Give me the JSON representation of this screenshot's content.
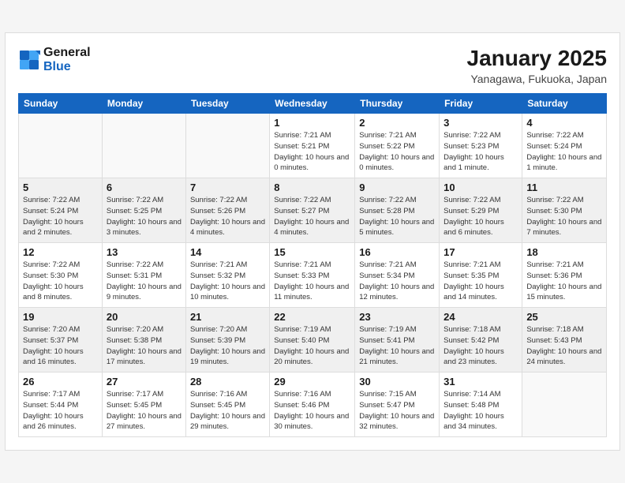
{
  "header": {
    "logo_general": "General",
    "logo_blue": "Blue",
    "month_title": "January 2025",
    "location": "Yanagawa, Fukuoka, Japan"
  },
  "weekdays": [
    "Sunday",
    "Monday",
    "Tuesday",
    "Wednesday",
    "Thursday",
    "Friday",
    "Saturday"
  ],
  "weeks": [
    {
      "shaded": false,
      "days": [
        {
          "day": "",
          "info": ""
        },
        {
          "day": "",
          "info": ""
        },
        {
          "day": "",
          "info": ""
        },
        {
          "day": "1",
          "info": "Sunrise: 7:21 AM\nSunset: 5:21 PM\nDaylight: 10 hours\nand 0 minutes."
        },
        {
          "day": "2",
          "info": "Sunrise: 7:21 AM\nSunset: 5:22 PM\nDaylight: 10 hours\nand 0 minutes."
        },
        {
          "day": "3",
          "info": "Sunrise: 7:22 AM\nSunset: 5:23 PM\nDaylight: 10 hours\nand 1 minute."
        },
        {
          "day": "4",
          "info": "Sunrise: 7:22 AM\nSunset: 5:24 PM\nDaylight: 10 hours\nand 1 minute."
        }
      ]
    },
    {
      "shaded": true,
      "days": [
        {
          "day": "5",
          "info": "Sunrise: 7:22 AM\nSunset: 5:24 PM\nDaylight: 10 hours\nand 2 minutes."
        },
        {
          "day": "6",
          "info": "Sunrise: 7:22 AM\nSunset: 5:25 PM\nDaylight: 10 hours\nand 3 minutes."
        },
        {
          "day": "7",
          "info": "Sunrise: 7:22 AM\nSunset: 5:26 PM\nDaylight: 10 hours\nand 4 minutes."
        },
        {
          "day": "8",
          "info": "Sunrise: 7:22 AM\nSunset: 5:27 PM\nDaylight: 10 hours\nand 4 minutes."
        },
        {
          "day": "9",
          "info": "Sunrise: 7:22 AM\nSunset: 5:28 PM\nDaylight: 10 hours\nand 5 minutes."
        },
        {
          "day": "10",
          "info": "Sunrise: 7:22 AM\nSunset: 5:29 PM\nDaylight: 10 hours\nand 6 minutes."
        },
        {
          "day": "11",
          "info": "Sunrise: 7:22 AM\nSunset: 5:30 PM\nDaylight: 10 hours\nand 7 minutes."
        }
      ]
    },
    {
      "shaded": false,
      "days": [
        {
          "day": "12",
          "info": "Sunrise: 7:22 AM\nSunset: 5:30 PM\nDaylight: 10 hours\nand 8 minutes."
        },
        {
          "day": "13",
          "info": "Sunrise: 7:22 AM\nSunset: 5:31 PM\nDaylight: 10 hours\nand 9 minutes."
        },
        {
          "day": "14",
          "info": "Sunrise: 7:21 AM\nSunset: 5:32 PM\nDaylight: 10 hours\nand 10 minutes."
        },
        {
          "day": "15",
          "info": "Sunrise: 7:21 AM\nSunset: 5:33 PM\nDaylight: 10 hours\nand 11 minutes."
        },
        {
          "day": "16",
          "info": "Sunrise: 7:21 AM\nSunset: 5:34 PM\nDaylight: 10 hours\nand 12 minutes."
        },
        {
          "day": "17",
          "info": "Sunrise: 7:21 AM\nSunset: 5:35 PM\nDaylight: 10 hours\nand 14 minutes."
        },
        {
          "day": "18",
          "info": "Sunrise: 7:21 AM\nSunset: 5:36 PM\nDaylight: 10 hours\nand 15 minutes."
        }
      ]
    },
    {
      "shaded": true,
      "days": [
        {
          "day": "19",
          "info": "Sunrise: 7:20 AM\nSunset: 5:37 PM\nDaylight: 10 hours\nand 16 minutes."
        },
        {
          "day": "20",
          "info": "Sunrise: 7:20 AM\nSunset: 5:38 PM\nDaylight: 10 hours\nand 17 minutes."
        },
        {
          "day": "21",
          "info": "Sunrise: 7:20 AM\nSunset: 5:39 PM\nDaylight: 10 hours\nand 19 minutes."
        },
        {
          "day": "22",
          "info": "Sunrise: 7:19 AM\nSunset: 5:40 PM\nDaylight: 10 hours\nand 20 minutes."
        },
        {
          "day": "23",
          "info": "Sunrise: 7:19 AM\nSunset: 5:41 PM\nDaylight: 10 hours\nand 21 minutes."
        },
        {
          "day": "24",
          "info": "Sunrise: 7:18 AM\nSunset: 5:42 PM\nDaylight: 10 hours\nand 23 minutes."
        },
        {
          "day": "25",
          "info": "Sunrise: 7:18 AM\nSunset: 5:43 PM\nDaylight: 10 hours\nand 24 minutes."
        }
      ]
    },
    {
      "shaded": false,
      "days": [
        {
          "day": "26",
          "info": "Sunrise: 7:17 AM\nSunset: 5:44 PM\nDaylight: 10 hours\nand 26 minutes."
        },
        {
          "day": "27",
          "info": "Sunrise: 7:17 AM\nSunset: 5:45 PM\nDaylight: 10 hours\nand 27 minutes."
        },
        {
          "day": "28",
          "info": "Sunrise: 7:16 AM\nSunset: 5:45 PM\nDaylight: 10 hours\nand 29 minutes."
        },
        {
          "day": "29",
          "info": "Sunrise: 7:16 AM\nSunset: 5:46 PM\nDaylight: 10 hours\nand 30 minutes."
        },
        {
          "day": "30",
          "info": "Sunrise: 7:15 AM\nSunset: 5:47 PM\nDaylight: 10 hours\nand 32 minutes."
        },
        {
          "day": "31",
          "info": "Sunrise: 7:14 AM\nSunset: 5:48 PM\nDaylight: 10 hours\nand 34 minutes."
        },
        {
          "day": "",
          "info": ""
        }
      ]
    }
  ]
}
